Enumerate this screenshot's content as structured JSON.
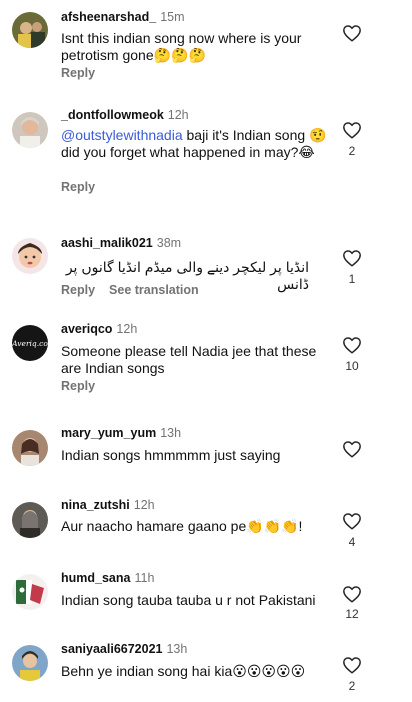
{
  "comments": [
    {
      "user": "afsheenarshad_",
      "time": "15m",
      "text": "Isnt this indian song now where is your petrotism gone🤔🤔🤔",
      "reply": "Reply",
      "likes": ""
    },
    {
      "user": "_dontfollowmeok",
      "time": "12h",
      "mention": "@outstylewithnadia",
      "text": " baji it's Indian song 🤨did you forget what happened in may?😂",
      "reply": "Reply",
      "likes": "2"
    },
    {
      "user": "aashi_malik021",
      "time": "38m",
      "text": "انڈیا پر لیکچر دینے والی میڈم انڈیا گانوں پر ڈانس",
      "reply": "Reply",
      "see_translation": "See translation",
      "likes": "1"
    },
    {
      "user": "averiqco",
      "time": "12h",
      "text": "Someone please tell Nadia jee that these are Indian songs",
      "reply": "Reply",
      "likes": "10",
      "avatar_text": "Averiq.co"
    },
    {
      "user": "mary_yum_yum",
      "time": "13h",
      "text": "Indian songs hmmmmm just saying",
      "reply": "",
      "likes": ""
    },
    {
      "user": "nina_zutshi",
      "time": "12h",
      "text": "Aur naacho hamare gaano pe👏👏👏!",
      "reply": "",
      "likes": "4"
    },
    {
      "user": "humd_sana",
      "time": "11h",
      "text": "Indian song tauba tauba u r not Pakistani",
      "reply": "",
      "likes": "12"
    },
    {
      "user": "saniyaali6672021",
      "time": "13h",
      "text": "Behn ye indian song hai kia😮😮😮😮😮",
      "reply": "",
      "likes": "2"
    }
  ],
  "colors": {
    "text": "#111111",
    "muted": "#737373",
    "mention": "#3b5bdb"
  },
  "icons": {
    "like": "heart-outline-icon"
  }
}
